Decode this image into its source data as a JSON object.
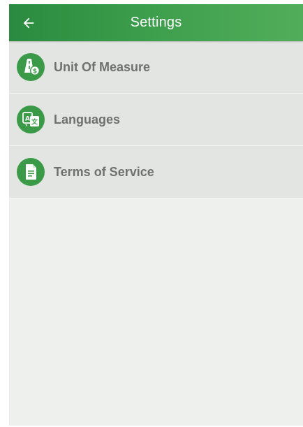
{
  "app_bar": {
    "title": "Settings",
    "back_icon": "arrow-left-icon"
  },
  "menu": {
    "items": [
      {
        "label": "Unit Of Measure",
        "icon": "road-dollar-icon"
      },
      {
        "label": "Languages",
        "icon": "translate-icon"
      },
      {
        "label": "Terms of Service",
        "icon": "document-icon"
      }
    ]
  },
  "colors": {
    "accent_green": "#3a9a48",
    "label_gray": "#707070",
    "background": "#edf0ed"
  }
}
